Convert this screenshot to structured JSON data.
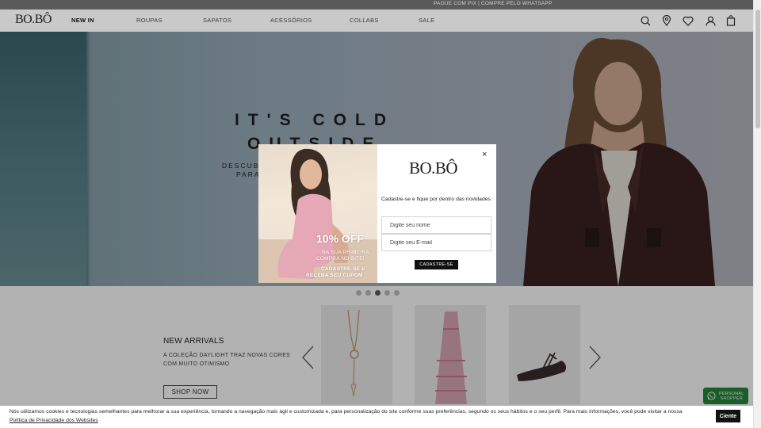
{
  "topbar": {
    "text": "PAGUE COM PIX | COMPRE PELO WHATSAPP"
  },
  "header": {
    "logo": "BO.BÔ",
    "nav": [
      "NEW IN",
      "ROUPAS",
      "SAPATOS",
      "ACESSÓRIOS",
      "COLLABS",
      "SALE"
    ],
    "icons": [
      "search-icon",
      "location-icon",
      "heart-icon",
      "user-icon",
      "bag-icon"
    ]
  },
  "hero": {
    "title_line1": "IT'S COLD",
    "title_line2": "OUTSIDE",
    "sub_line1": "DESCUBRA A NOVA COLEÇÃO",
    "sub_line2": "PARA O INVERNO",
    "slides_total": 5,
    "active_slide": 3
  },
  "modal": {
    "logo": "BO.BÔ",
    "close": "×",
    "heading": "Cadastre-se e fique por dentro das novidades",
    "name_placeholder": "Digite seu nome",
    "email_placeholder": "Digite seu E-mail",
    "submit": "CADASTRE-SE",
    "promo": {
      "discount": "10% OFF",
      "line1": "NA SUA PRIMEIRA",
      "line2": "COMPRA NO SITE!",
      "line3": "CADASTRE-SE E",
      "line4": "RECEBA SEU CUPOM"
    }
  },
  "arrivals": {
    "title": "NEW ARRIVALS",
    "desc_line1": "A COLEÇÃO DAYLIGHT TRAZ NOVAS CORES",
    "desc_line2": "COM MUITO OTIMISMO",
    "button": "SHOP NOW",
    "products": [
      "necklace",
      "floral-dress",
      "strappy-sandal"
    ]
  },
  "whatsapp": {
    "line1": "PERSONAL",
    "line2": "SHOPPER"
  },
  "cookie": {
    "text": "Nós utilizamos cookies e tecnologias semelhantes para melhorar a sua experiência, tornando a navegação mais ágil e customizada e, para personalização do site conforme suas preferências, segundo os seus hábitos e o seu perfil. Para mais informações, você pode visitar a nossa",
    "link": "Política de Privacidade dos Websites",
    "button": "Ciente"
  },
  "colors": {
    "overlay": "#000000",
    "whatsapp": "#25863a",
    "accent": "#111111"
  }
}
